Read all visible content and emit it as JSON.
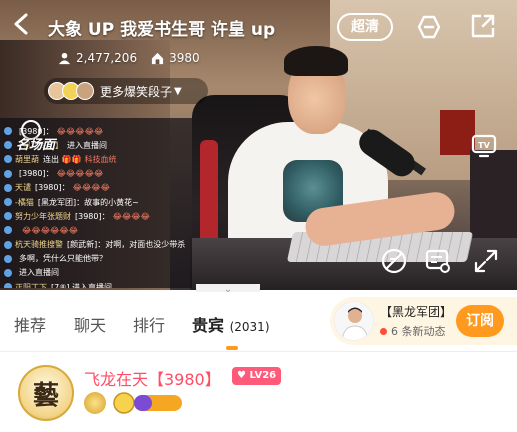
{
  "header": {
    "title": "大象 UP 我爱书生哥 许皇 up",
    "quality_label": "超清"
  },
  "stats": {
    "viewers": "2,477,206",
    "fans": "3980"
  },
  "tag_pill": {
    "label": "更多爆笑段子"
  },
  "chat": {
    "famous_label": "名场面",
    "messages": [
      {
        "name": "",
        "text": "[3980]：",
        "emoji": "😂😂😂😂😂"
      },
      {
        "name": "【黑龙军团】",
        "text": "进入直播间",
        "emoji": ""
      },
      {
        "name": "葫里葫",
        "text": "连出 🎁🎁",
        "emoji": "科技血统"
      },
      {
        "name": "",
        "text": "[3980]：",
        "emoji": "😂😂😂😂😂"
      },
      {
        "name": "天谴",
        "text": "[3980]：",
        "emoji": "😂😂😂😂"
      },
      {
        "name": "-橘猫",
        "text": "[黑龙军团]：故事的小黄花~",
        "emoji": ""
      },
      {
        "name": "努力少年张题财",
        "text": "[3980]：",
        "emoji": "😂😂😂😂"
      },
      {
        "name": "",
        "text": "",
        "emoji": "😂😂😂😂😂😂"
      },
      {
        "name": "杭天骑推搜警",
        "text": "[颜武新]：对啊，对面也没少带杀",
        "emoji": ""
      },
      {
        "name": "",
        "text": "多啊，凭什么只能他带？",
        "emoji": ""
      },
      {
        "name": "",
        "text": "进入直播间",
        "emoji": ""
      },
      {
        "name": "正阳丁下",
        "text": "[7⑧] 进入直播间",
        "emoji": ""
      }
    ]
  },
  "tabs": [
    {
      "label": "推荐"
    },
    {
      "label": "聊天"
    },
    {
      "label": "排行"
    },
    {
      "label": "贵宾",
      "count": "(2031)"
    }
  ],
  "fan_group": {
    "title": "【黑龙军团】",
    "subtitle": "6 条新动态",
    "follow_label": "订阅"
  },
  "vip_list": [
    {
      "name": "飞龙在天【3980】",
      "level": "LV26",
      "avatar_glyph": "藝"
    }
  ],
  "colors": {
    "accent": "#ff9a1f",
    "vip_name": "#ff4d66",
    "level_badge": "#ff5a7a"
  }
}
